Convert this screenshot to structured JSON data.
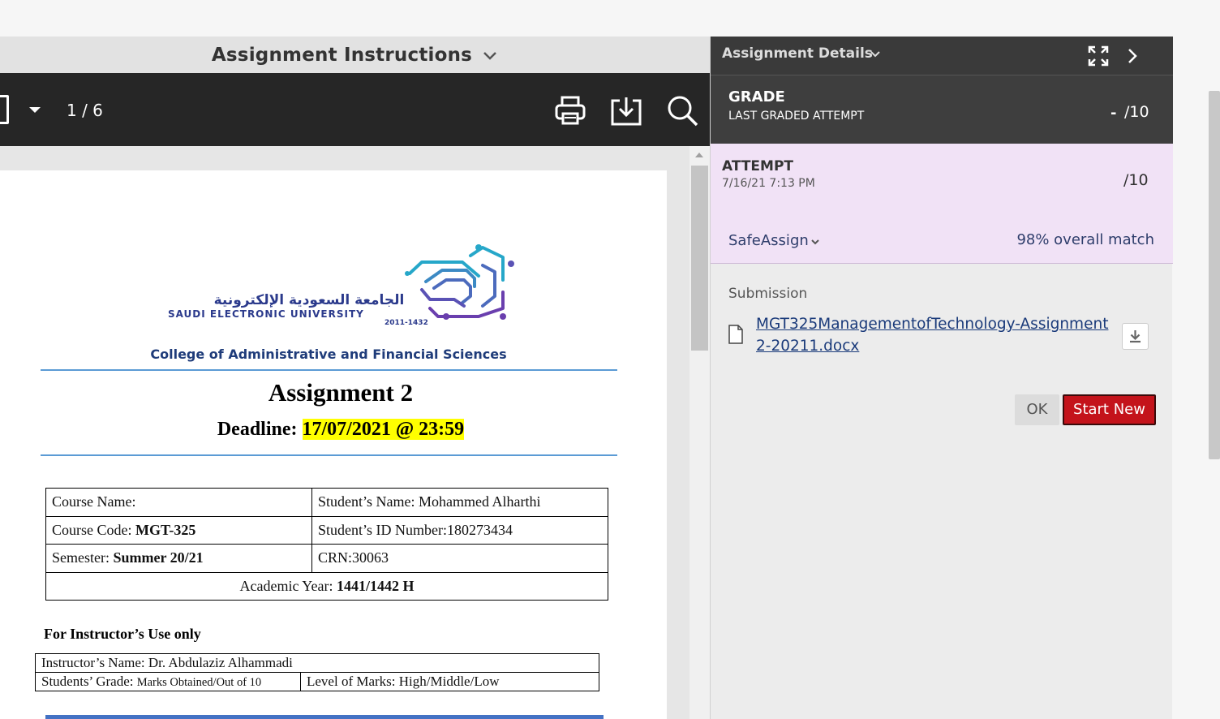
{
  "left_panel": {
    "header_title": "Assignment Instructions",
    "page_indicator": "1 / 6"
  },
  "document": {
    "university_ar": "الجامعة السعودية الإلكترونية",
    "university_en": "SAUDI ELECTRONIC UNIVERSITY",
    "university_years": "2011-1432",
    "college": "College of Administrative and Financial Sciences",
    "title": "Assignment 2",
    "deadline_label": "Deadline: ",
    "deadline_value": "17/07/2021 @ 23:59",
    "info_table": {
      "course_name_label": "Course Name:",
      "student_name": "Student’s Name: Mohammed Alharthi",
      "course_code_label": "Course Code: ",
      "course_code_value": "MGT-325",
      "student_id": "Student’s ID Number:180273434",
      "semester_label": "Semester: ",
      "semester_value": "Summer 20/21",
      "crn": "CRN:30063",
      "academic_year_label": "Academic Year: ",
      "academic_year_value": "1441/1442 H"
    },
    "instructor_heading": "For Instructor’s Use only",
    "instructor_table": {
      "instructor_name": "Instructor’s Name: Dr. Abdulaziz Alhammadi",
      "grade_label": "Students’ Grade: ",
      "grade_value": "Marks Obtained/Out of 10",
      "level": "Level of Marks: High/Middle/Low"
    }
  },
  "right_panel": {
    "header_title": "Assignment Details",
    "grade": {
      "label": "GRADE",
      "sublabel": "LAST GRADED ATTEMPT",
      "score": "-",
      "out_of": "/10"
    },
    "attempt": {
      "label": "ATTEMPT",
      "timestamp": "7/16/21 7:13 PM",
      "out_of": "/10",
      "safeassign_label": "SafeAssign",
      "match": "98% overall match"
    },
    "submission_label": "Submission",
    "file_name": "MGT325ManagementofTechnology-Assignment 2-20211.docx",
    "ok_label": "OK",
    "start_new_label": "Start New"
  },
  "colors": {
    "start_new": "#c4131b",
    "attempt_bg": "#f1e2f6",
    "deadline_highlight": "#ffff00",
    "link": "#1a3a7a"
  },
  "icons": [
    "chevron-down-icon",
    "page-view-icon",
    "print-icon",
    "download-icon",
    "search-icon",
    "expand-icon",
    "chevron-right-icon",
    "file-icon"
  ]
}
